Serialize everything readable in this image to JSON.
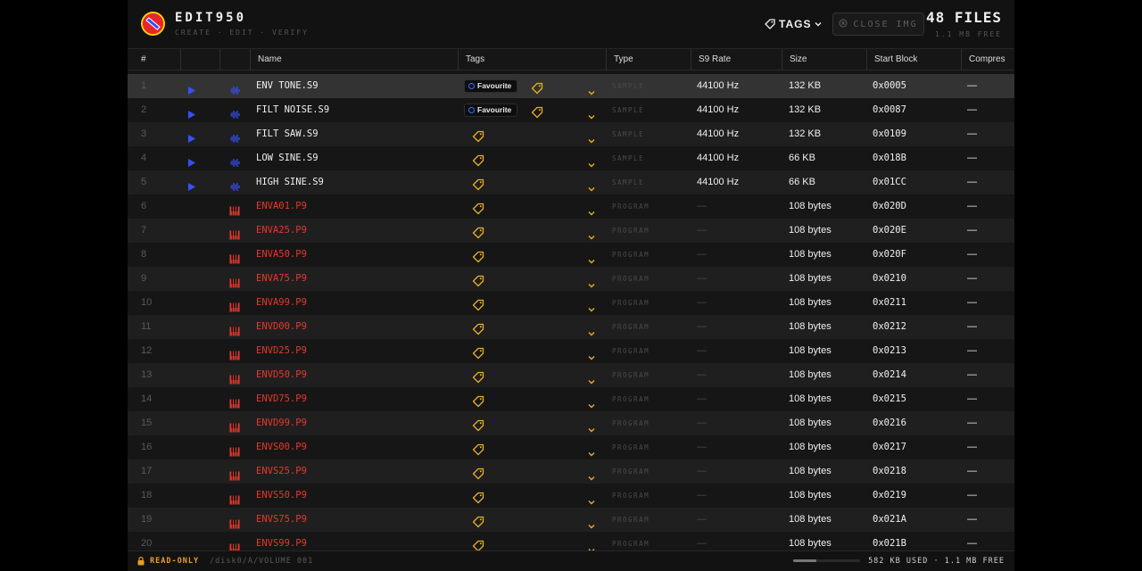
{
  "app": {
    "title": "EDIT950",
    "subtitle": "CREATE · EDIT · VERIFY"
  },
  "header": {
    "tags_label": "TAGS",
    "close_label": "CLOSE IMG",
    "files_count": "48 FILES",
    "free": "1.1 MB FREE"
  },
  "columns": [
    "#",
    "",
    "",
    "Name",
    "Tags",
    "Type",
    "S9 Rate",
    "Size",
    "Start Block",
    "Compres"
  ],
  "rows": [
    {
      "num": "1",
      "name": "ENV TONE.S9",
      "kind": "sample",
      "favourite": true,
      "type": "SAMPLE",
      "rate": "44100 Hz",
      "size": "132 KB",
      "block": "0x0005",
      "comp": "—",
      "selected": true
    },
    {
      "num": "2",
      "name": "FILT NOISE.S9",
      "kind": "sample",
      "favourite": true,
      "type": "SAMPLE",
      "rate": "44100 Hz",
      "size": "132 KB",
      "block": "0x0087",
      "comp": "—"
    },
    {
      "num": "3",
      "name": "FILT SAW.S9",
      "kind": "sample",
      "favourite": false,
      "type": "SAMPLE",
      "rate": "44100 Hz",
      "size": "132 KB",
      "block": "0x0109",
      "comp": "—"
    },
    {
      "num": "4",
      "name": "LOW SINE.S9",
      "kind": "sample",
      "favourite": false,
      "type": "SAMPLE",
      "rate": "44100 Hz",
      "size": "66 KB",
      "block": "0x018B",
      "comp": "—"
    },
    {
      "num": "5",
      "name": "HIGH SINE.S9",
      "kind": "sample",
      "favourite": false,
      "type": "SAMPLE",
      "rate": "44100 Hz",
      "size": "66 KB",
      "block": "0x01CC",
      "comp": "—"
    },
    {
      "num": "6",
      "name": "ENVA01.P9",
      "kind": "program",
      "favourite": false,
      "type": "PROGRAM",
      "rate": "—",
      "size": "108 bytes",
      "block": "0x020D",
      "comp": "—"
    },
    {
      "num": "7",
      "name": "ENVA25.P9",
      "kind": "program",
      "favourite": false,
      "type": "PROGRAM",
      "rate": "—",
      "size": "108 bytes",
      "block": "0x020E",
      "comp": "—"
    },
    {
      "num": "8",
      "name": "ENVA50.P9",
      "kind": "program",
      "favourite": false,
      "type": "PROGRAM",
      "rate": "—",
      "size": "108 bytes",
      "block": "0x020F",
      "comp": "—"
    },
    {
      "num": "9",
      "name": "ENVA75.P9",
      "kind": "program",
      "favourite": false,
      "type": "PROGRAM",
      "rate": "—",
      "size": "108 bytes",
      "block": "0x0210",
      "comp": "—"
    },
    {
      "num": "10",
      "name": "ENVA99.P9",
      "kind": "program",
      "favourite": false,
      "type": "PROGRAM",
      "rate": "—",
      "size": "108 bytes",
      "block": "0x0211",
      "comp": "—"
    },
    {
      "num": "11",
      "name": "ENVD00.P9",
      "kind": "program",
      "favourite": false,
      "type": "PROGRAM",
      "rate": "—",
      "size": "108 bytes",
      "block": "0x0212",
      "comp": "—"
    },
    {
      "num": "12",
      "name": "ENVD25.P9",
      "kind": "program",
      "favourite": false,
      "type": "PROGRAM",
      "rate": "—",
      "size": "108 bytes",
      "block": "0x0213",
      "comp": "—"
    },
    {
      "num": "13",
      "name": "ENVD50.P9",
      "kind": "program",
      "favourite": false,
      "type": "PROGRAM",
      "rate": "—",
      "size": "108 bytes",
      "block": "0x0214",
      "comp": "—"
    },
    {
      "num": "14",
      "name": "ENVD75.P9",
      "kind": "program",
      "favourite": false,
      "type": "PROGRAM",
      "rate": "—",
      "size": "108 bytes",
      "block": "0x0215",
      "comp": "—"
    },
    {
      "num": "15",
      "name": "ENVD99.P9",
      "kind": "program",
      "favourite": false,
      "type": "PROGRAM",
      "rate": "—",
      "size": "108 bytes",
      "block": "0x0216",
      "comp": "—"
    },
    {
      "num": "16",
      "name": "ENVS00.P9",
      "kind": "program",
      "favourite": false,
      "type": "PROGRAM",
      "rate": "—",
      "size": "108 bytes",
      "block": "0x0217",
      "comp": "—"
    },
    {
      "num": "17",
      "name": "ENVS25.P9",
      "kind": "program",
      "favourite": false,
      "type": "PROGRAM",
      "rate": "—",
      "size": "108 bytes",
      "block": "0x0218",
      "comp": "—"
    },
    {
      "num": "18",
      "name": "ENVS50.P9",
      "kind": "program",
      "favourite": false,
      "type": "PROGRAM",
      "rate": "—",
      "size": "108 bytes",
      "block": "0x0219",
      "comp": "—"
    },
    {
      "num": "19",
      "name": "ENVS75.P9",
      "kind": "program",
      "favourite": false,
      "type": "PROGRAM",
      "rate": "—",
      "size": "108 bytes",
      "block": "0x021A",
      "comp": "—"
    },
    {
      "num": "20",
      "name": "ENVS99.P9",
      "kind": "program",
      "favourite": false,
      "type": "PROGRAM",
      "rate": "—",
      "size": "108 bytes",
      "block": "0x021B",
      "comp": "—"
    }
  ],
  "favourite_label": "Favourite",
  "status": {
    "readonly": "READ-ONLY",
    "path": "/disk0/A/VOLUME 001",
    "usage": "582 KB USED · 1.1 MB FREE",
    "usage_fraction": 0.34
  },
  "colors": {
    "accent_blue": "#3750ff",
    "program_red": "#e23a2c",
    "tag_yellow": "#e8b020",
    "readonly_orange": "#e8a020"
  }
}
